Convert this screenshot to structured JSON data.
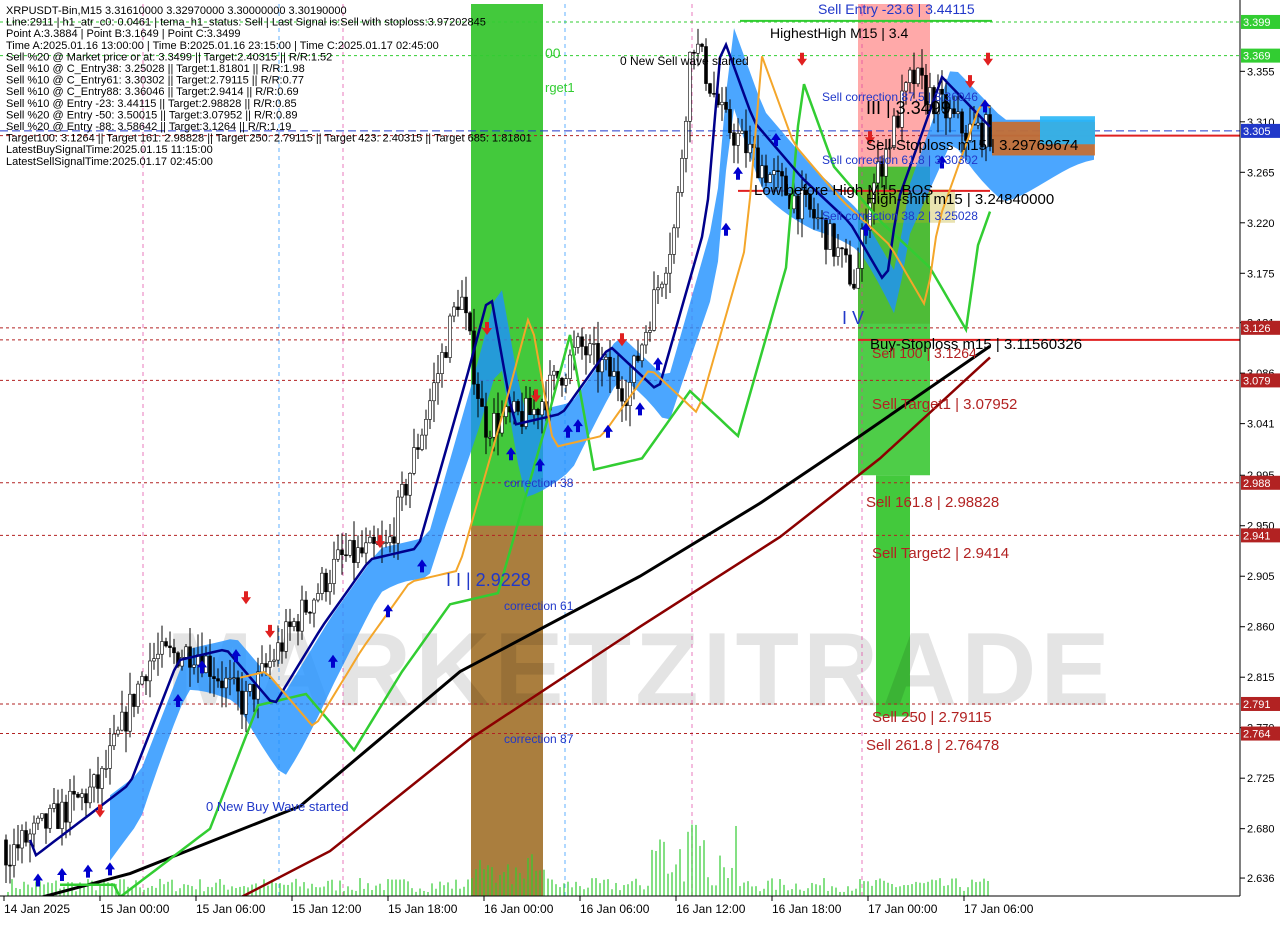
{
  "info_lines": [
    "XRPUSDT-Bin,M15  3.31610000 3.32970000 3.30000000 3.30190000",
    "Line:2911 | h1_atr_c0: 0.0461 | tema_h1_status: Sell | Last Signal is:Sell with stoploss:3.97202845",
    "Point A:3.3884 | Point B:3.1649 | Point C:3.3499",
    "Time A:2025.01.16 13:00:00 | Time B:2025.01.16 23:15:00 | Time C:2025.01.17 02:45:00",
    "Sell %20 @ Market price or at: 3.3499 || Target:2.40315 || R/R:1.52",
    "Sell %10 @ C_Entry38: 3.25028 || Target:1.81801 || R/R:1.98",
    "Sell %10 @ C_Entry61: 3.30302 || Target:2.79115 || R/R:0.77",
    "Sell %10 @ C_Entry88: 3.36046 || Target:2.9414 || R/R:0.69",
    "Sell %10 @ Entry -23: 3.44115 || Target:2.98828 || R/R:0.85",
    "Sell %20 @ Entry -50: 3.50015 || Target:3.07952 || R/R:0.89",
    "Sell %20 @ Entry -88: 3.58642 || Target:3.1264 || R/R:1.19",
    "Target100: 3.1264 || Target 161: 2.98828 || Target 250: 2.79115 || Target 423: 2.40315 || Target 685: 1.81801",
    "LatestBuySignalTime:2025.01.15 11:15:00",
    "LatestSellSignalTime:2025.01.17 02:45:00"
  ],
  "annotations": {
    "sell_entry": "Sell Entry -23.6 | 3.44115",
    "highest_high": "HighestHigh   M15 | 3.4",
    "new_sell_wave": "0 New Sell wave started",
    "sell_correction_875": "Sell correction 87.5 | 3.36046",
    "wave_iii": "III | 3.3499",
    "sell_stoploss": "Sell-Stoploss m15 | 3.29769674",
    "sell_correction_618": "Sell correction 61.8 | 3.30302",
    "low_before_high": "Low before High   M15-BOS",
    "high_shift": "High-shift m15 | 3.24840000",
    "sell_correction_382": "Sell correction 38.2 | 3.25028",
    "wave_iv": "I V",
    "buy_stoploss": "Buy-Stoploss m15 | 3.11560326",
    "sell_100": "Sell 100 | 3.1264",
    "sell_target1": "Sell Target1 | 3.07952",
    "sell_1618": "Sell 161.8 | 2.98828",
    "sell_target2": "Sell Target2 | 2.9414",
    "wave_ii": "I I | 2.9228",
    "correction_38": "correction 38",
    "correction_61": "correction 61",
    "correction_87": "correction 87",
    "sell_250": "Sell  250 | 2.79115",
    "sell_2618": "Sell  261.8 | 2.76478",
    "new_buy_wave": "0 New Buy Wave started",
    "label_00": "00",
    "label_target1": "rget1"
  },
  "watermark": "MARKETZITRADE",
  "colors": {
    "bull_candle": "#000000",
    "level_red": "#b22222",
    "current_price": "#2138c9",
    "ma_black": "#000000",
    "ma_darkred": "#8b0000",
    "ma_green": "#32cd32",
    "ma_navy": "#00008b",
    "ma_orange": "#f4a62a",
    "cloud_blue": "#1e90ff",
    "cloud_orange": "#d2691e",
    "zone_green": "#22c01a",
    "zone_red": "#ff4040"
  },
  "chart_data": {
    "type": "candlestick",
    "symbol": "XRPUSDT-Bin",
    "timeframe": "M15",
    "ohlc_current": {
      "open": 3.3161,
      "high": 3.3297,
      "low": 3.3,
      "close": 3.3019
    },
    "ylim": [
      2.62,
      3.415
    ],
    "y_ticks": [
      2.636,
      2.68,
      2.725,
      2.77,
      2.815,
      2.86,
      2.905,
      2.95,
      2.995,
      3.041,
      3.086,
      3.131,
      3.175,
      3.22,
      3.265,
      3.31,
      3.355
    ],
    "x_ticks": [
      "14 Jan 2025",
      "15 Jan 00:00",
      "15 Jan 06:00",
      "15 Jan 12:00",
      "15 Jan 18:00",
      "16 Jan 00:00",
      "16 Jan 06:00",
      "16 Jan 12:00",
      "16 Jan 18:00",
      "17 Jan 00:00",
      "17 Jan 06:00"
    ],
    "price_tags": [
      {
        "label": "3.399",
        "value": 3.399,
        "color": "#32cd32"
      },
      {
        "label": "3.369",
        "value": 3.369,
        "color": "#32cd32"
      },
      {
        "label": "3.305",
        "value": 3.3019,
        "color": "#2138c9"
      },
      {
        "label": "3.126",
        "value": 3.1264,
        "color": "#b22222"
      },
      {
        "label": "3.079",
        "value": 3.07952,
        "color": "#b22222"
      },
      {
        "label": "2.988",
        "value": 2.98828,
        "color": "#b22222"
      },
      {
        "label": "2.941",
        "value": 2.9414,
        "color": "#b22222"
      },
      {
        "label": "2.791",
        "value": 2.79115,
        "color": "#b22222"
      },
      {
        "label": "2.764",
        "value": 2.76478,
        "color": "#b22222"
      }
    ],
    "close_path": [
      [
        "14 Jan 2025",
        2.67
      ],
      [
        "14 Jan 18:00",
        2.655
      ],
      [
        "15 Jan 00:00",
        2.72
      ],
      [
        "15 Jan 03:00",
        2.83
      ],
      [
        "15 Jan 06:00",
        2.84
      ],
      [
        "15 Jan 09:00",
        2.79
      ],
      [
        "15 Jan 12:00",
        2.86
      ],
      [
        "15 Jan 15:00",
        2.92
      ],
      [
        "15 Jan 18:00",
        2.93
      ],
      [
        "15 Jan 21:00",
        3.08
      ],
      [
        "15 Jan 22:30",
        3.16
      ],
      [
        "16 Jan 00:00",
        3.04
      ],
      [
        "16 Jan 03:00",
        3.05
      ],
      [
        "16 Jan 06:00",
        3.11
      ],
      [
        "16 Jan 09:00",
        3.07
      ],
      [
        "16 Jan 12:00",
        3.22
      ],
      [
        "16 Jan 13:00",
        3.3884
      ],
      [
        "16 Jan 15:00",
        3.31
      ],
      [
        "16 Jan 18:00",
        3.26
      ],
      [
        "16 Jan 21:00",
        3.22
      ],
      [
        "16 Jan 23:15",
        3.1649
      ],
      [
        "17 Jan 00:00",
        3.24
      ],
      [
        "17 Jan 02:45",
        3.3499
      ],
      [
        "17 Jan 06:00",
        3.3019
      ]
    ],
    "levels": [
      3.399,
      3.369,
      3.29769674,
      3.1264,
      3.11560326,
      3.07952,
      2.98828,
      2.9414,
      2.79115,
      2.76478
    ]
  }
}
